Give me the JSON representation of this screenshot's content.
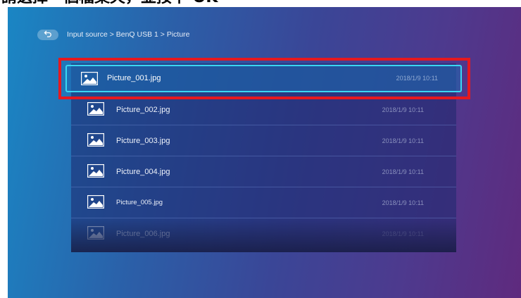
{
  "caption": "請選擇一個檔案夾，並按下 OK",
  "breadcrumb": {
    "path": "Input source > BenQ USB 1 > Picture"
  },
  "files": [
    {
      "name": "Picture_001.jpg",
      "date": "2018/1/9 10:11",
      "icon": "image-file-icon"
    },
    {
      "name": "Picture_002.jpg",
      "date": "2018/1/9 10:11",
      "icon": "image-file-icon"
    },
    {
      "name": "Picture_003.jpg",
      "date": "2018/1/9 10:11",
      "icon": "image-file-icon"
    },
    {
      "name": "Picture_004.jpg",
      "date": "2018/1/9 10:11",
      "icon": "image-file-icon"
    },
    {
      "name": "Picture_005.jpg",
      "date": "2018/1/9 10:11",
      "icon": "image-file-icon"
    },
    {
      "name": "Picture_006.jpg",
      "date": "2018/1/9 10:11",
      "icon": "image-file-icon"
    }
  ],
  "colors": {
    "highlight_border": "#e5191f",
    "focus_border": "#3ad6f2"
  }
}
